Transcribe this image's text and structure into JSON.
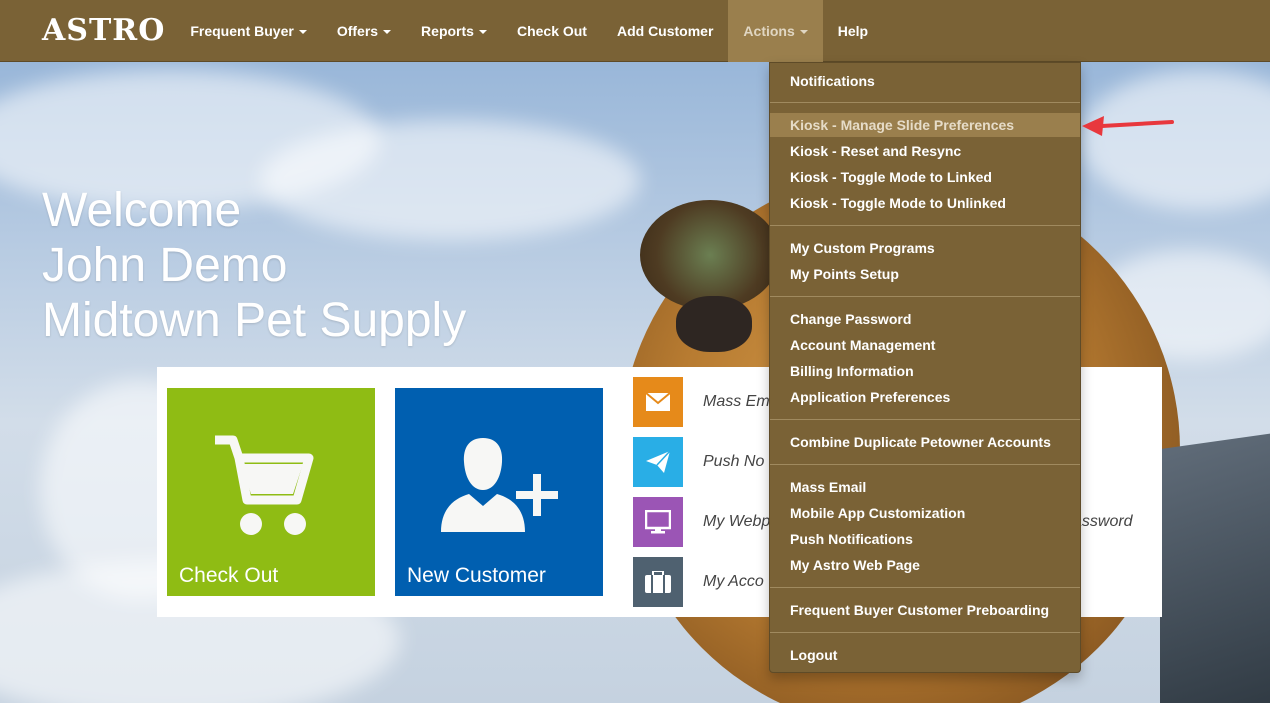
{
  "nav": {
    "logo": "ASTRO",
    "items": [
      {
        "label": "Frequent Buyer",
        "caret": true
      },
      {
        "label": "Offers",
        "caret": true
      },
      {
        "label": "Reports",
        "caret": true
      },
      {
        "label": "Check Out",
        "caret": false
      },
      {
        "label": "Add Customer",
        "caret": false
      },
      {
        "label": "Actions",
        "caret": true,
        "active": true
      },
      {
        "label": "Help",
        "caret": false
      }
    ]
  },
  "welcome": {
    "line1": "Welcome",
    "line2": "John Demo",
    "line3": "Midtown Pet Supply"
  },
  "tiles": {
    "checkout": {
      "label": "Check Out",
      "color": "#8fbc14",
      "icon": "cart-icon"
    },
    "new_customer": {
      "label": "New Customer",
      "color": "#005fb0",
      "icon": "add-user-icon"
    }
  },
  "shortcuts": [
    {
      "label": "Mass Em",
      "color": "#e68a1a",
      "icon": "envelope-icon"
    },
    {
      "label": "Push No",
      "color": "#29aee6",
      "icon": "paper-plane-icon"
    },
    {
      "label": "My Webp",
      "color": "#9b55b5",
      "icon": "monitor-icon"
    },
    {
      "label": "My Acco",
      "color": "#4f6170",
      "icon": "briefcase-icon"
    }
  ],
  "right_text": "assword",
  "actions_menu": {
    "groups": [
      [
        "Notifications"
      ],
      [
        "Kiosk - Manage Slide Preferences",
        "Kiosk - Reset and Resync",
        "Kiosk - Toggle Mode to Linked",
        "Kiosk - Toggle Mode to Unlinked"
      ],
      [
        "My Custom Programs",
        "My Points Setup"
      ],
      [
        "Change Password",
        "Account Management",
        "Billing Information",
        "Application Preferences"
      ],
      [
        "Combine Duplicate Petowner Accounts"
      ],
      [
        "Mass Email",
        "Mobile App Customization",
        "Push Notifications",
        "My Astro Web Page"
      ],
      [
        "Frequent Buyer Customer Preboarding"
      ],
      [
        "Logout"
      ]
    ],
    "highlighted": "Kiosk - Manage Slide Preferences"
  },
  "colors": {
    "navbar": "#7a6236",
    "highlight": "#9a7f4d",
    "annotation_arrow": "#e8383d"
  }
}
